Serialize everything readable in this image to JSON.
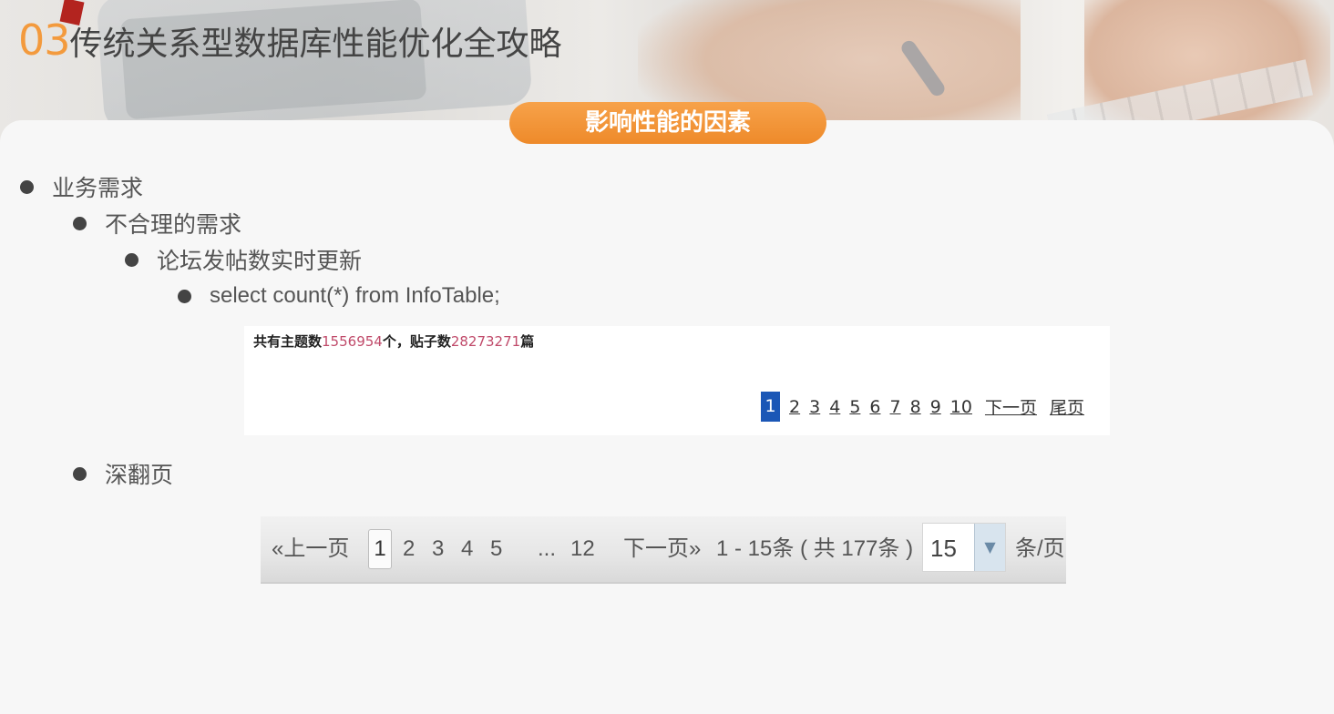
{
  "slide": {
    "title_number": "03",
    "title_text": "传统关系型数据库性能优化全攻略",
    "section_label": "影响性能的因素"
  },
  "bullets": {
    "level1": "业务需求",
    "level2": "不合理的需求",
    "level3": "论坛发帖数实时更新",
    "level4": "select count(*) from InfoTable;",
    "level2b": "深翻页"
  },
  "forum": {
    "stats_prefix": "共有主题数",
    "topics": "1556954",
    "stats_mid": "个，贴子数",
    "posts": "28273271",
    "stats_suffix": "篇",
    "pages": [
      "1",
      "2",
      "3",
      "4",
      "5",
      "6",
      "7",
      "8",
      "9",
      "10"
    ],
    "current_page": "1",
    "next": "下一页",
    "last": "尾页"
  },
  "deep_pager": {
    "prev": "«上一页",
    "current": "1",
    "pages": [
      "2",
      "3",
      "4",
      "5"
    ],
    "ellipsis": "...",
    "last_page": "12",
    "next": "下一页»",
    "range": "1 - 15条 ( 共  177条 )",
    "page_size": "15",
    "dropdown_icon": "▼",
    "per_page": "条/页"
  }
}
